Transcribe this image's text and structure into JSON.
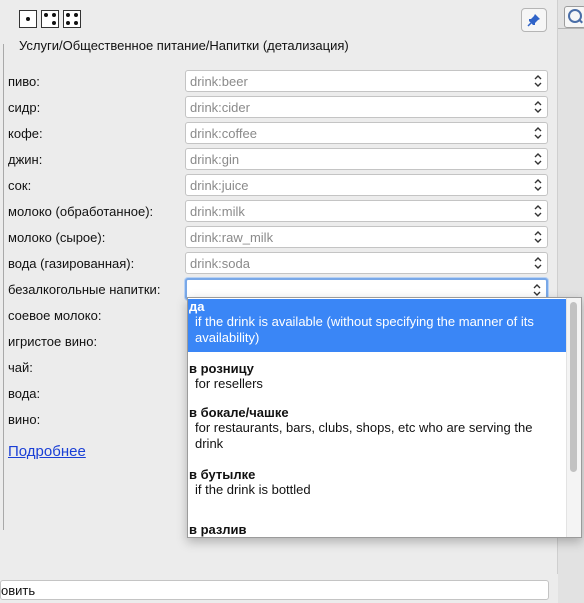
{
  "header": {
    "title": "Услуги/Общественное питание/Напитки (детализация)"
  },
  "fields": [
    {
      "label": "пиво:",
      "value": "drink:beer"
    },
    {
      "label": "сидр:",
      "value": "drink:cider"
    },
    {
      "label": "кофе:",
      "value": "drink:coffee"
    },
    {
      "label": "джин:",
      "value": "drink:gin"
    },
    {
      "label": "сок:",
      "value": "drink:juice"
    },
    {
      "label": "молоко (обработанное):",
      "value": "drink:milk"
    },
    {
      "label": "молоко (сырое):",
      "value": "drink:raw_milk"
    },
    {
      "label": "вода (газированная):",
      "value": "drink:soda"
    },
    {
      "label": "безалкогольные напитки:",
      "value": ""
    },
    {
      "label": "соевое молоко:",
      "value": ""
    },
    {
      "label": "игристое вино:",
      "value": ""
    },
    {
      "label": "чай:",
      "value": ""
    },
    {
      "label": "вода:",
      "value": ""
    },
    {
      "label": "вино:",
      "value": ""
    }
  ],
  "more_link": "Подробнее",
  "footer": {
    "text": "овить"
  },
  "dropdown": {
    "options": [
      {
        "title": "да",
        "desc": "if the drink is available (without specifying the manner of its availability)",
        "selected": true
      },
      {
        "title": "в розницу",
        "desc": "for resellers",
        "selected": false
      },
      {
        "title": "в бокале/чашке",
        "desc": "for restaurants, bars, clubs, shops, etc who are serving the drink",
        "selected": false
      },
      {
        "title": "в бутылке",
        "desc": "if the drink is bottled",
        "selected": false
      },
      {
        "title": "в разлив",
        "desc": "",
        "selected": false
      }
    ]
  },
  "colors": {
    "selection": "#3a86f6",
    "link": "#1a3fd6",
    "placeholder": "#8a8a8a"
  }
}
